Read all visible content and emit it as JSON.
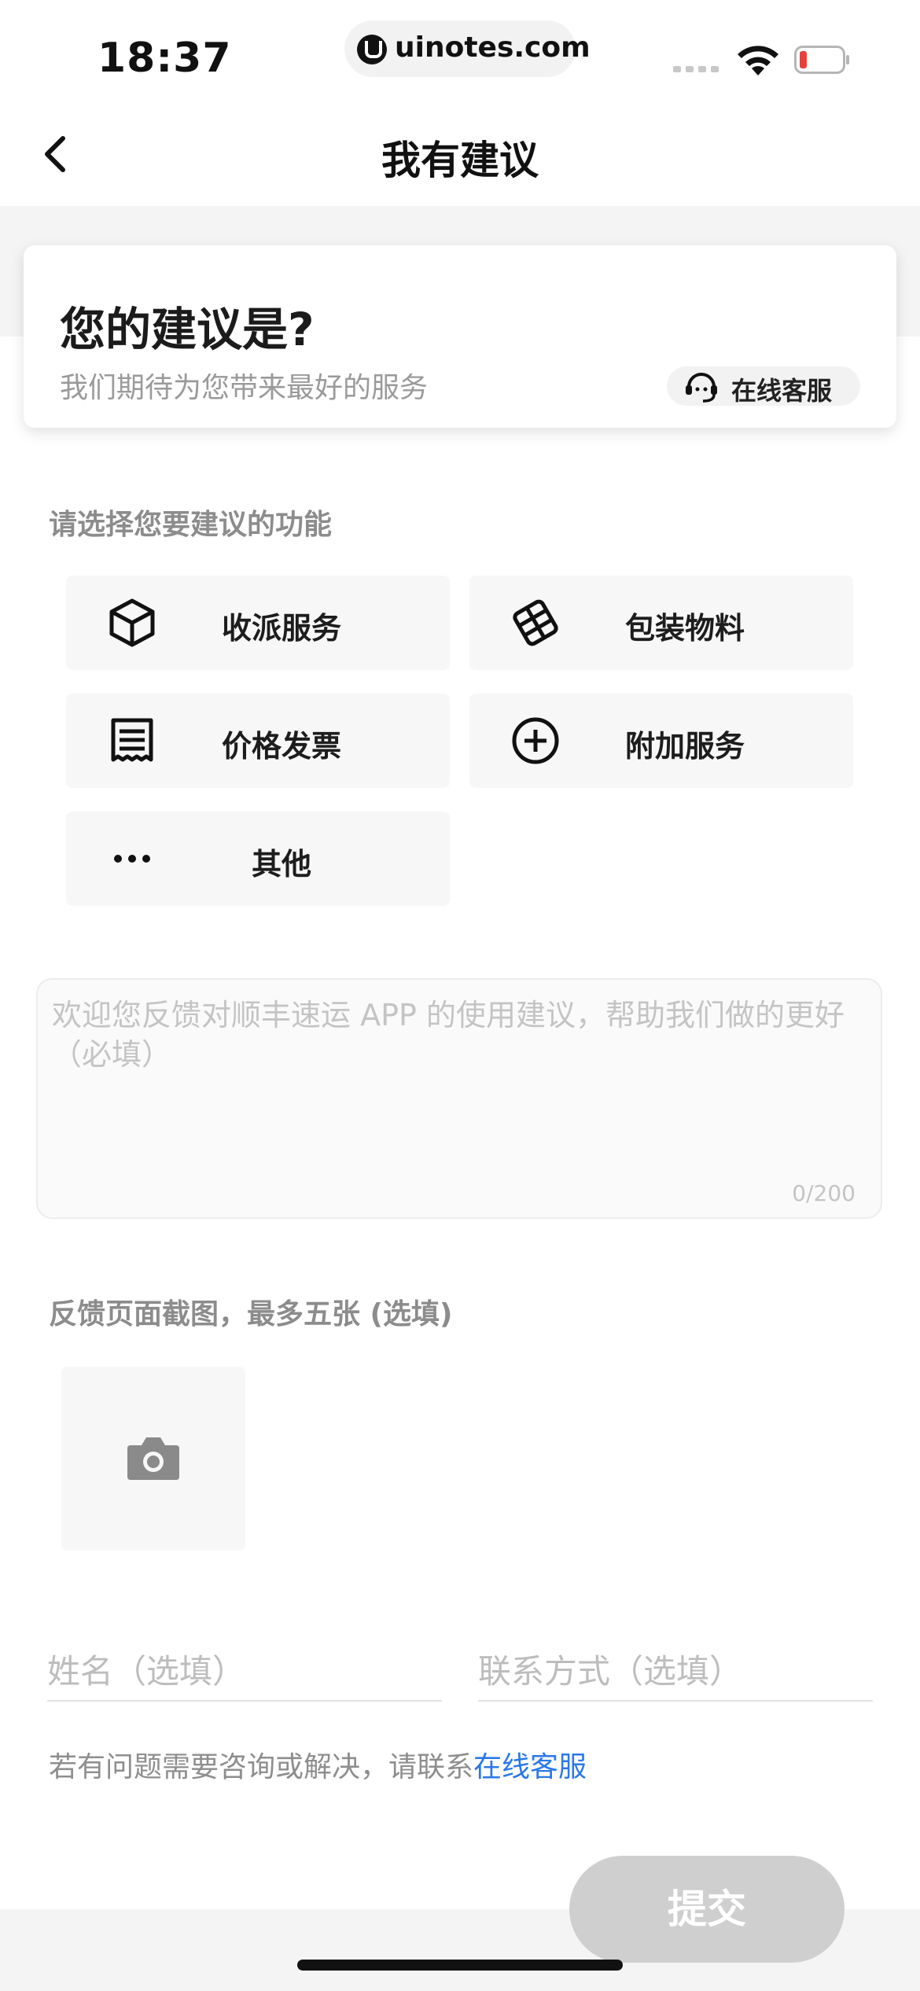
{
  "status_bar": {
    "time": "18:37",
    "url": "uinotes.com"
  },
  "nav": {
    "title": "我有建议",
    "back_icon": "chevron-left-icon"
  },
  "intro": {
    "title": "您的建议是?",
    "subtitle": "我们期待为您带来最好的服务",
    "cs_button_label": "在线客服",
    "cs_icon": "headset-icon"
  },
  "functions": {
    "label": "请选择您要建议的功能",
    "items": [
      {
        "label": "收派服务",
        "icon": "package-cube-icon"
      },
      {
        "label": "包装物料",
        "icon": "material-grid-icon"
      },
      {
        "label": "价格发票",
        "icon": "receipt-icon"
      },
      {
        "label": "附加服务",
        "icon": "plus-circle-icon"
      },
      {
        "label": "其他",
        "icon": "more-dots-icon"
      }
    ]
  },
  "feedback": {
    "placeholder": "欢迎您反馈对顺丰速运 APP 的使用建议，帮助我们做的更好（必填）",
    "value": "",
    "count": "0/200"
  },
  "screenshots": {
    "label": "反馈页面截图，最多五张 (选填)",
    "add_icon": "camera-icon"
  },
  "contact": {
    "name_placeholder": "姓名（选填）",
    "contact_placeholder": "联系方式（选填）"
  },
  "help": {
    "text": "若有问题需要咨询或解决，请联系",
    "link": "在线客服"
  },
  "submit": {
    "label": "提交"
  },
  "colors": {
    "link": "#2b78e8",
    "submit_disabled": "#cfcfcf"
  }
}
